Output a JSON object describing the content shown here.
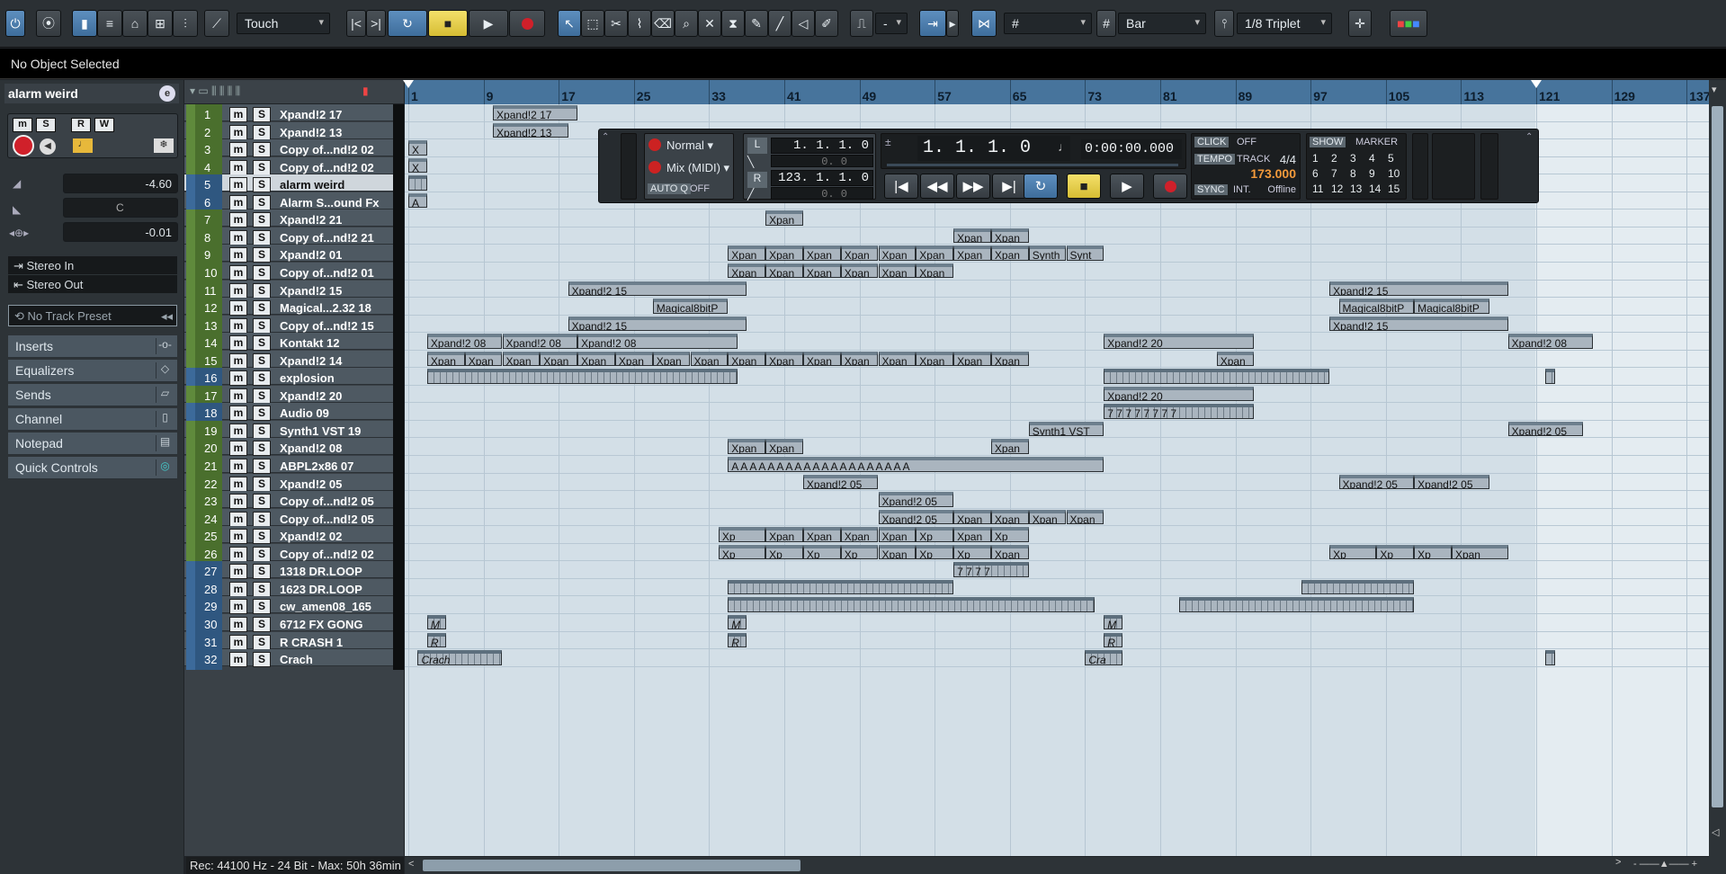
{
  "toolbar": {
    "automation_mode": "Touch",
    "grid_type": "Bar",
    "quantize": "1/8 Triplet",
    "nudge_value": "-",
    "icons": [
      "activate-project-icon",
      "constrain-delay-icon",
      "show-inspector-icon",
      "show-info-icon",
      "show-overview-icon",
      "show-pool-icon",
      "show-mixer-icon",
      "automation-icon",
      "go-to-start-icon",
      "go-to-end-icon",
      "cycle-icon",
      "stop-icon",
      "play-icon",
      "record-icon",
      "object-select-icon",
      "range-select-icon",
      "split-icon",
      "glue-icon",
      "erase-icon",
      "zoom-icon",
      "mute-icon",
      "time-warp-icon",
      "draw-icon",
      "line-icon",
      "play-tool-icon",
      "color-tool-icon",
      "snap-icon",
      "grid-icon",
      "quantize-icon",
      "colors-menu-icon"
    ]
  },
  "info_line": {
    "text": "No Object Selected"
  },
  "inspector": {
    "track_name": "alarm weird",
    "volume": "-4.60",
    "pan": "C",
    "delay": "-0.01",
    "input": "Stereo In",
    "output": "Stereo Out",
    "track_preset": "No Track Preset",
    "sections": [
      "Inserts",
      "Equalizers",
      "Sends",
      "Channel",
      "Notepad",
      "Quick Controls"
    ],
    "record_format": "Rec: 44100 Hz - 24 Bit - Max: 50h 36min"
  },
  "tracks": [
    {
      "num": "1",
      "name": "Xpand!2 17",
      "type": "midi"
    },
    {
      "num": "2",
      "name": "Xpand!2 13",
      "type": "midi"
    },
    {
      "num": "3",
      "name": "Copy of...nd!2 02",
      "type": "midi"
    },
    {
      "num": "4",
      "name": "Copy of...nd!2 02",
      "type": "midi"
    },
    {
      "num": "5",
      "name": "alarm weird",
      "type": "audio",
      "selected": true
    },
    {
      "num": "6",
      "name": "Alarm S...ound Fx",
      "type": "audio"
    },
    {
      "num": "7",
      "name": "Xpand!2 21",
      "type": "midi"
    },
    {
      "num": "8",
      "name": "Copy of...nd!2 21",
      "type": "midi"
    },
    {
      "num": "9",
      "name": "Xpand!2 01",
      "type": "midi"
    },
    {
      "num": "10",
      "name": "Copy of...nd!2 01",
      "type": "midi"
    },
    {
      "num": "11",
      "name": "Xpand!2 15",
      "type": "midi"
    },
    {
      "num": "12",
      "name": "Magical...2.32 18",
      "type": "midi"
    },
    {
      "num": "13",
      "name": "Copy of...nd!2 15",
      "type": "midi"
    },
    {
      "num": "14",
      "name": "Kontakt 12",
      "type": "midi"
    },
    {
      "num": "15",
      "name": "Xpand!2 14",
      "type": "midi"
    },
    {
      "num": "16",
      "name": "explosion",
      "type": "audio"
    },
    {
      "num": "17",
      "name": "Xpand!2 20",
      "type": "midi"
    },
    {
      "num": "18",
      "name": "Audio 09",
      "type": "audio"
    },
    {
      "num": "19",
      "name": "Synth1 VST 19",
      "type": "midi"
    },
    {
      "num": "20",
      "name": "Xpand!2 08",
      "type": "midi"
    },
    {
      "num": "21",
      "name": "ABPL2x86 07",
      "type": "midi"
    },
    {
      "num": "22",
      "name": "Xpand!2 05",
      "type": "midi"
    },
    {
      "num": "23",
      "name": "Copy of...nd!2 05",
      "type": "midi"
    },
    {
      "num": "24",
      "name": "Copy of...nd!2 05",
      "type": "midi"
    },
    {
      "num": "25",
      "name": "Xpand!2 02",
      "type": "midi"
    },
    {
      "num": "26",
      "name": "Copy of...nd!2 02",
      "type": "midi"
    },
    {
      "num": "27",
      "name": "1318 DR.LOOP",
      "type": "audio"
    },
    {
      "num": "28",
      "name": "1623 DR.LOOP",
      "type": "audio"
    },
    {
      "num": "29",
      "name": "cw_amen08_165",
      "type": "audio"
    },
    {
      "num": "30",
      "name": "6712 FX GONG",
      "type": "audio"
    },
    {
      "num": "31",
      "name": "R CRASH 1",
      "type": "audio"
    },
    {
      "num": "32",
      "name": "Crach",
      "type": "audio"
    }
  ],
  "ruler": {
    "bars": [
      1,
      9,
      17,
      25,
      33,
      41,
      49,
      57,
      65,
      73,
      81,
      89,
      97,
      105,
      113,
      121,
      129,
      137
    ],
    "left_locator": 1,
    "right_locator": 121
  },
  "events": [
    {
      "t": 0,
      "b": 10,
      "e": 19,
      "l": "Xpand!2 17"
    },
    {
      "t": 1,
      "b": 10,
      "e": 18,
      "l": "Xpand!2 13"
    },
    {
      "t": 2,
      "b": 1,
      "e": 3,
      "l": "X"
    },
    {
      "t": 3,
      "b": 1,
      "e": 3,
      "l": "X"
    },
    {
      "t": 4,
      "b": 1,
      "e": 3,
      "l": "",
      "a": 1
    },
    {
      "t": 5,
      "b": 1,
      "e": 3,
      "l": "A"
    },
    {
      "t": 6,
      "b": 39,
      "e": 43,
      "l": "Xpan"
    },
    {
      "t": 7,
      "b": 59,
      "e": 63,
      "l": "Xpan"
    },
    {
      "t": 7,
      "b": 63,
      "e": 67,
      "l": "Xpan"
    },
    {
      "t": 8,
      "b": 35,
      "e": 39,
      "l": "Xpan"
    },
    {
      "t": 8,
      "b": 39,
      "e": 43,
      "l": "Xpan"
    },
    {
      "t": 8,
      "b": 43,
      "e": 47,
      "l": "Xpan"
    },
    {
      "t": 8,
      "b": 47,
      "e": 51,
      "l": "Xpan"
    },
    {
      "t": 8,
      "b": 51,
      "e": 55,
      "l": "Xpan"
    },
    {
      "t": 8,
      "b": 55,
      "e": 59,
      "l": "Xpan"
    },
    {
      "t": 8,
      "b": 59,
      "e": 63,
      "l": "Xpan"
    },
    {
      "t": 8,
      "b": 63,
      "e": 67,
      "l": "Xpan"
    },
    {
      "t": 8,
      "b": 67,
      "e": 71,
      "l": "Synth"
    },
    {
      "t": 8,
      "b": 71,
      "e": 75,
      "l": "Synt"
    },
    {
      "t": 9,
      "b": 35,
      "e": 39,
      "l": "Xpan"
    },
    {
      "t": 9,
      "b": 39,
      "e": 43,
      "l": "Xpan"
    },
    {
      "t": 9,
      "b": 43,
      "e": 47,
      "l": "Xpan"
    },
    {
      "t": 9,
      "b": 47,
      "e": 51,
      "l": "Xpan"
    },
    {
      "t": 9,
      "b": 51,
      "e": 55,
      "l": "Xpan"
    },
    {
      "t": 9,
      "b": 55,
      "e": 59,
      "l": "Xpan"
    },
    {
      "t": 10,
      "b": 18,
      "e": 37,
      "l": "Xpand!2 15"
    },
    {
      "t": 10,
      "b": 99,
      "e": 118,
      "l": "Xpand!2 15"
    },
    {
      "t": 11,
      "b": 27,
      "e": 35,
      "l": "Magical8bitP"
    },
    {
      "t": 11,
      "b": 100,
      "e": 108,
      "l": "Magical8bitP"
    },
    {
      "t": 11,
      "b": 108,
      "e": 116,
      "l": "Magical8bitP"
    },
    {
      "t": 12,
      "b": 18,
      "e": 37,
      "l": "Xpand!2 15"
    },
    {
      "t": 12,
      "b": 99,
      "e": 118,
      "l": "Xpand!2 15"
    },
    {
      "t": 13,
      "b": 3,
      "e": 11,
      "l": "Xpand!2 08"
    },
    {
      "t": 13,
      "b": 11,
      "e": 19,
      "l": "Xpand!2 08"
    },
    {
      "t": 13,
      "b": 19,
      "e": 36,
      "l": "Xpand!2 08"
    },
    {
      "t": 13,
      "b": 75,
      "e": 91,
      "l": "Xpand!2 20"
    },
    {
      "t": 13,
      "b": 118,
      "e": 127,
      "l": "Xpand!2 08"
    },
    {
      "t": 14,
      "b": 3,
      "e": 7,
      "l": "Xpan"
    },
    {
      "t": 14,
      "b": 7,
      "e": 11,
      "l": "Xpan"
    },
    {
      "t": 14,
      "b": 11,
      "e": 15,
      "l": "Xpan"
    },
    {
      "t": 14,
      "b": 15,
      "e": 19,
      "l": "Xpan"
    },
    {
      "t": 14,
      "b": 19,
      "e": 23,
      "l": "Xpan"
    },
    {
      "t": 14,
      "b": 23,
      "e": 27,
      "l": "Xpan"
    },
    {
      "t": 14,
      "b": 27,
      "e": 31,
      "l": "Xpan"
    },
    {
      "t": 14,
      "b": 31,
      "e": 35,
      "l": "Xpan"
    },
    {
      "t": 14,
      "b": 35,
      "e": 39,
      "l": "Xpan"
    },
    {
      "t": 14,
      "b": 39,
      "e": 43,
      "l": "Xpan"
    },
    {
      "t": 14,
      "b": 43,
      "e": 47,
      "l": "Xpan"
    },
    {
      "t": 14,
      "b": 47,
      "e": 51,
      "l": "Xpan"
    },
    {
      "t": 14,
      "b": 51,
      "e": 55,
      "l": "Xpan"
    },
    {
      "t": 14,
      "b": 55,
      "e": 59,
      "l": "Xpan"
    },
    {
      "t": 14,
      "b": 59,
      "e": 63,
      "l": "Xpan"
    },
    {
      "t": 14,
      "b": 63,
      "e": 67,
      "l": "Xpan"
    },
    {
      "t": 14,
      "b": 87,
      "e": 91,
      "l": "Xpan"
    },
    {
      "t": 15,
      "b": 3,
      "e": 36,
      "l": "",
      "a": 1
    },
    {
      "t": 15,
      "b": 75,
      "e": 99,
      "l": "",
      "a": 1
    },
    {
      "t": 15,
      "b": 122,
      "e": 123,
      "l": "",
      "a": 1
    },
    {
      "t": 16,
      "b": 75,
      "e": 91,
      "l": "Xpand!2 20"
    },
    {
      "t": 17,
      "b": 75,
      "e": 91,
      "l": "7 7 7 7 7 7 7 7",
      "a": 1
    },
    {
      "t": 18,
      "b": 67,
      "e": 75,
      "l": "Synth1 VST"
    },
    {
      "t": 18,
      "b": 118,
      "e": 126,
      "l": "Xpand!2 05"
    },
    {
      "t": 19,
      "b": 35,
      "e": 39,
      "l": "Xpan"
    },
    {
      "t": 19,
      "b": 39,
      "e": 43,
      "l": "Xpan"
    },
    {
      "t": 19,
      "b": 63,
      "e": 67,
      "l": "Xpan"
    },
    {
      "t": 20,
      "b": 35,
      "e": 75,
      "l": "A  A  A  A  A  A  A  A  A  A  A  A  A  A  A  A  A  A  A  A"
    },
    {
      "t": 21,
      "b": 43,
      "e": 51,
      "l": "Xpand!2 05"
    },
    {
      "t": 21,
      "b": 100,
      "e": 108,
      "l": "Xpand!2 05"
    },
    {
      "t": 21,
      "b": 108,
      "e": 116,
      "l": "Xpand!2 05"
    },
    {
      "t": 22,
      "b": 51,
      "e": 59,
      "l": "Xpand!2 05"
    },
    {
      "t": 23,
      "b": 51,
      "e": 59,
      "l": "Xpand!2 05"
    },
    {
      "t": 23,
      "b": 59,
      "e": 63,
      "l": "Xpan"
    },
    {
      "t": 23,
      "b": 63,
      "e": 67,
      "l": "Xpan"
    },
    {
      "t": 23,
      "b": 67,
      "e": 71,
      "l": "Xpan"
    },
    {
      "t": 23,
      "b": 71,
      "e": 75,
      "l": "Xpan"
    },
    {
      "t": 24,
      "b": 34,
      "e": 39,
      "l": "Xp"
    },
    {
      "t": 24,
      "b": 39,
      "e": 43,
      "l": "Xpan"
    },
    {
      "t": 24,
      "b": 43,
      "e": 47,
      "l": "Xpan"
    },
    {
      "t": 24,
      "b": 47,
      "e": 51,
      "l": "Xpan"
    },
    {
      "t": 24,
      "b": 51,
      "e": 55,
      "l": "Xpan"
    },
    {
      "t": 24,
      "b": 55,
      "e": 59,
      "l": "Xp"
    },
    {
      "t": 24,
      "b": 59,
      "e": 63,
      "l": "Xpan"
    },
    {
      "t": 24,
      "b": 63,
      "e": 67,
      "l": "Xp"
    },
    {
      "t": 25,
      "b": 34,
      "e": 39,
      "l": "Xp"
    },
    {
      "t": 25,
      "b": 39,
      "e": 43,
      "l": "Xp"
    },
    {
      "t": 25,
      "b": 43,
      "e": 47,
      "l": "Xp"
    },
    {
      "t": 25,
      "b": 47,
      "e": 51,
      "l": "Xp"
    },
    {
      "t": 25,
      "b": 51,
      "e": 55,
      "l": "Xpan"
    },
    {
      "t": 25,
      "b": 55,
      "e": 59,
      "l": "Xp"
    },
    {
      "t": 25,
      "b": 59,
      "e": 63,
      "l": "Xp"
    },
    {
      "t": 25,
      "b": 63,
      "e": 67,
      "l": "Xpan"
    },
    {
      "t": 25,
      "b": 99,
      "e": 104,
      "l": "Xp"
    },
    {
      "t": 25,
      "b": 104,
      "e": 108,
      "l": "Xp"
    },
    {
      "t": 25,
      "b": 108,
      "e": 112,
      "l": "Xp"
    },
    {
      "t": 25,
      "b": 112,
      "e": 118,
      "l": "Xpan"
    },
    {
      "t": 26,
      "b": 59,
      "e": 67,
      "l": "7 7 7 7",
      "a": 1
    },
    {
      "t": 27,
      "b": 35,
      "e": 59,
      "l": "",
      "a": 1
    },
    {
      "t": 27,
      "b": 96,
      "e": 108,
      "l": "",
      "a": 1
    },
    {
      "t": 28,
      "b": 35,
      "e": 74,
      "l": "",
      "a": 1
    },
    {
      "t": 28,
      "b": 83,
      "e": 108,
      "l": "",
      "a": 1
    },
    {
      "t": 29,
      "b": 3,
      "e": 5,
      "l": "M",
      "a": 1,
      "i": 1
    },
    {
      "t": 29,
      "b": 35,
      "e": 37,
      "l": "M",
      "a": 1,
      "i": 1
    },
    {
      "t": 29,
      "b": 75,
      "e": 77,
      "l": "M",
      "a": 1,
      "i": 1
    },
    {
      "t": 30,
      "b": 3,
      "e": 5,
      "l": "R",
      "a": 1,
      "i": 1
    },
    {
      "t": 30,
      "b": 35,
      "e": 37,
      "l": "R",
      "a": 1,
      "i": 1
    },
    {
      "t": 30,
      "b": 75,
      "e": 77,
      "l": "R",
      "a": 1,
      "i": 1
    },
    {
      "t": 31,
      "b": 2,
      "e": 11,
      "l": "Crach",
      "a": 1,
      "i": 1
    },
    {
      "t": 31,
      "b": 73,
      "e": 77,
      "l": "Cra",
      "a": 1,
      "i": 1
    },
    {
      "t": 31,
      "b": 122,
      "e": 123,
      "l": "",
      "a": 1
    }
  ],
  "transport": {
    "mode": "Normal",
    "record_mode": "Mix (MIDI)",
    "auto_quantize": "AUTO Q",
    "auto_q_value": "OFF",
    "left_locator": "1. 1. 1.   0",
    "left_offset": "0.   0",
    "right_locator": "123. 1. 1.   0",
    "right_offset": "0.   0",
    "position_bars": "1. 1. 1.   0",
    "position_time": "0:00:00.000",
    "click_label": "CLICK",
    "click_value": "OFF",
    "tempo_label": "TEMPO",
    "tempo_mode": "TRACK",
    "signature": "4/4",
    "tempo": "173.000",
    "sync_label": "SYNC",
    "sync_source": "INT.",
    "sync_status": "Offline",
    "show_label": "SHOW",
    "marker_label": "MARKER",
    "markers": [
      "1",
      "2",
      "3",
      "4",
      "5",
      "6",
      "7",
      "8",
      "9",
      "10",
      "11",
      "12",
      "13",
      "14",
      "15"
    ],
    "l_label": "L",
    "r_label": "R"
  }
}
